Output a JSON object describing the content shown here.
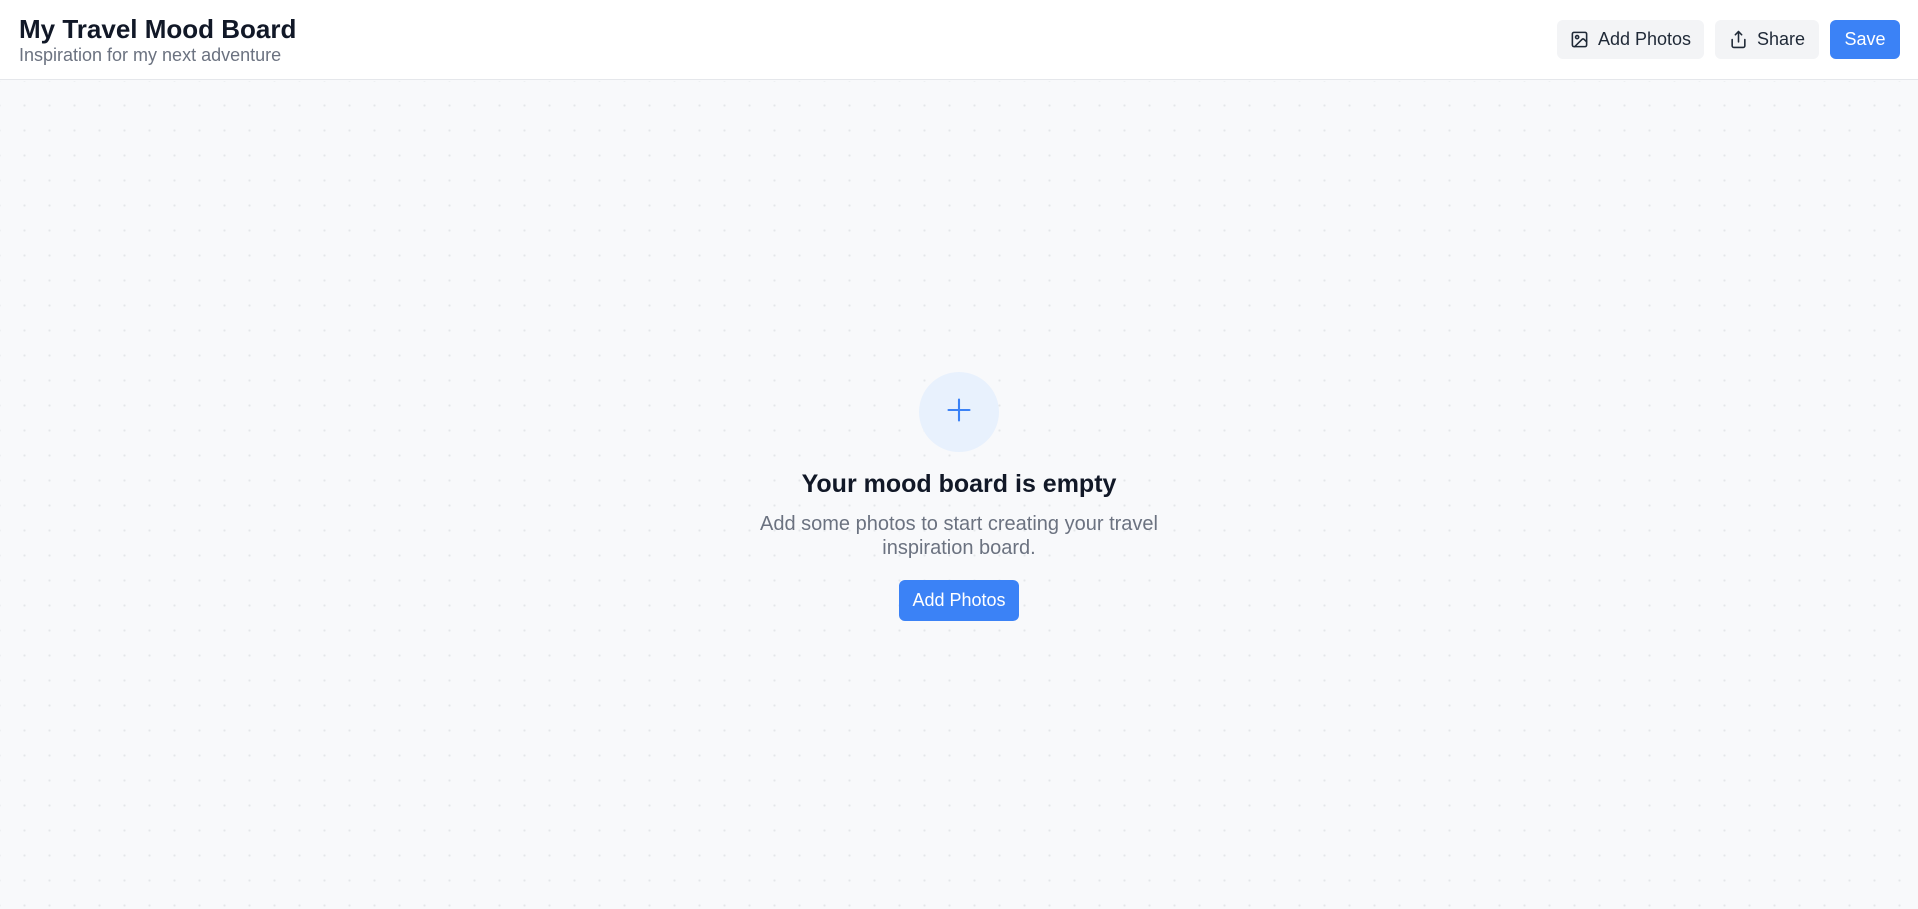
{
  "header": {
    "title": "My Travel Mood Board",
    "subtitle": "Inspiration for my next adventure",
    "buttons": {
      "add_photos": {
        "label": "Add Photos",
        "icon": "image-icon"
      },
      "share": {
        "label": "Share",
        "icon": "share-icon"
      },
      "save": {
        "label": "Save"
      }
    }
  },
  "empty_state": {
    "icon": "plus-icon",
    "title": "Your mood board is empty",
    "description": "Add some photos to start creating your travel inspiration board.",
    "button_label": "Add Photos"
  },
  "colors": {
    "accent": "#3b82f6",
    "accent_light": "#e8f1fd",
    "background": "#f8f9fb",
    "header_background": "#ffffff",
    "title_text": "#111827",
    "muted_text": "#6b7280",
    "secondary_button": "#f3f4f6"
  }
}
